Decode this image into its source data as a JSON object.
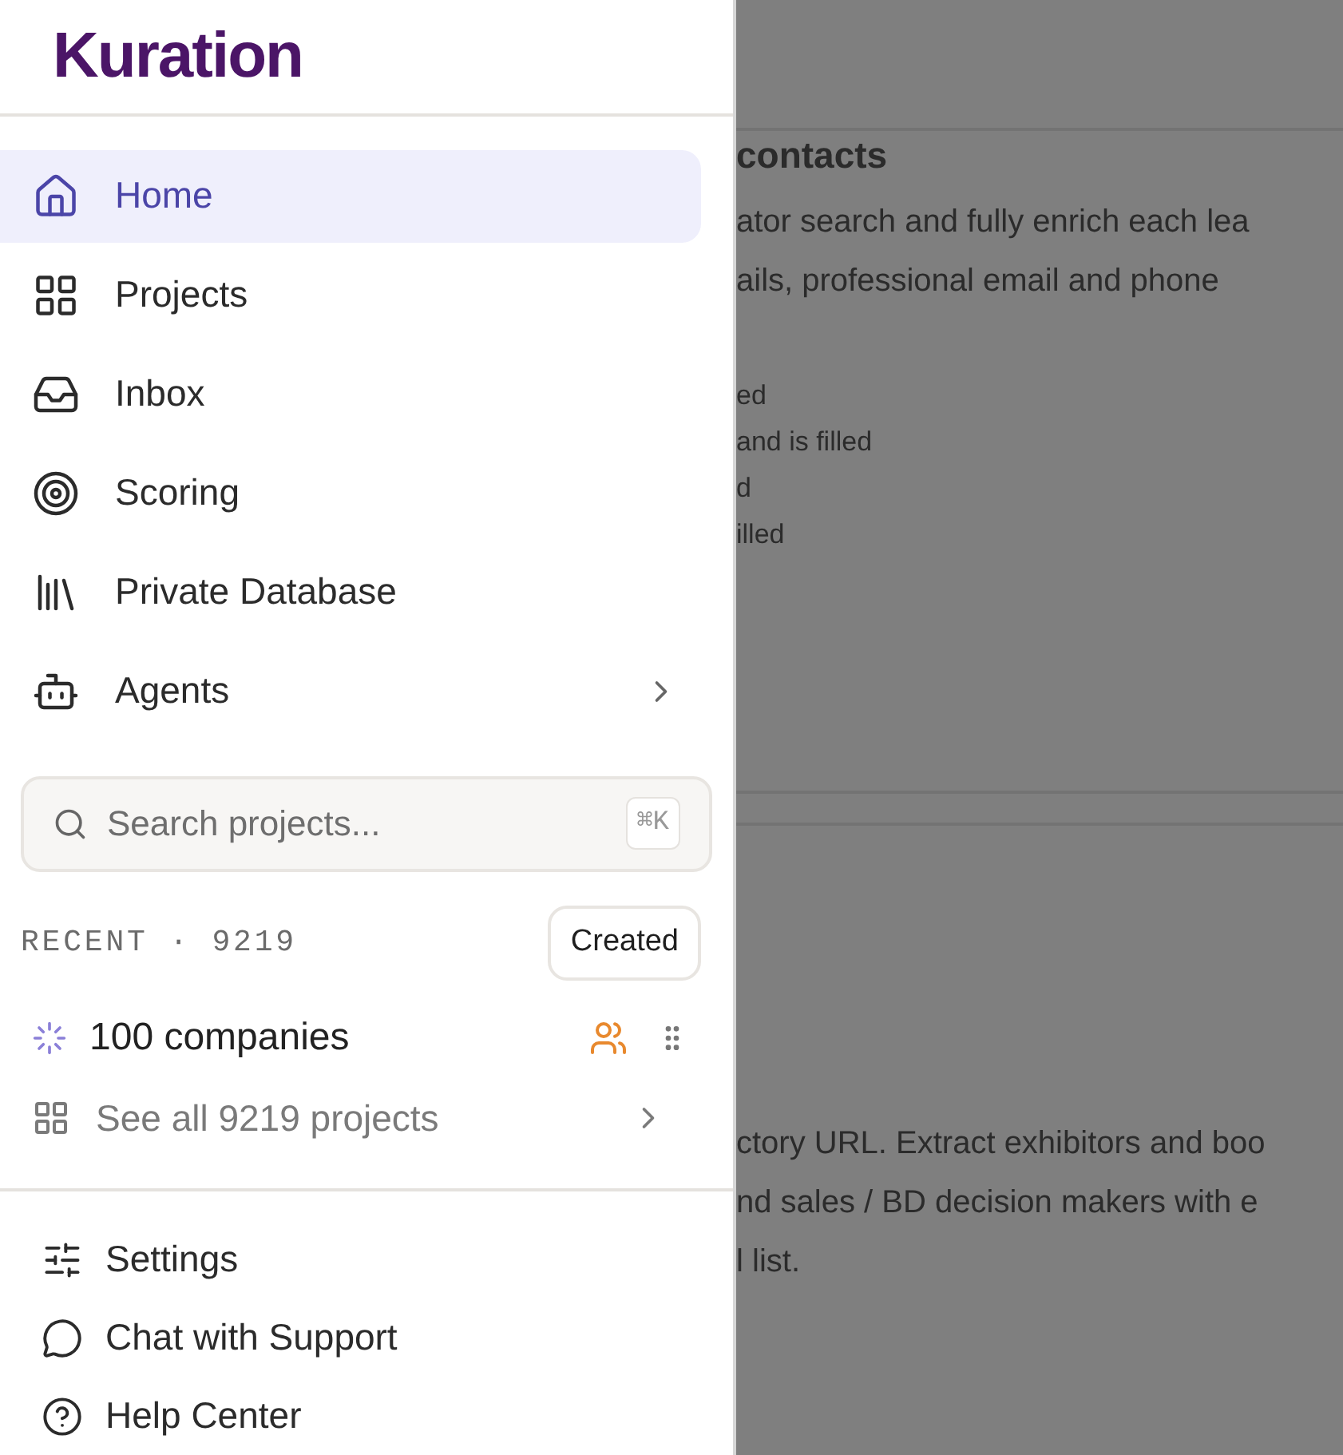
{
  "logo": "Kuration",
  "nav": [
    {
      "label": "Home",
      "selected": true,
      "has_submenu": false
    },
    {
      "label": "Projects",
      "selected": false,
      "has_submenu": false
    },
    {
      "label": "Inbox",
      "selected": false,
      "has_submenu": false
    },
    {
      "label": "Scoring",
      "selected": false,
      "has_submenu": false
    },
    {
      "label": "Private Database",
      "selected": false,
      "has_submenu": false
    },
    {
      "label": "Agents",
      "selected": false,
      "has_submenu": true
    }
  ],
  "search": {
    "placeholder": "Search projects...",
    "shortcut": "⌘K"
  },
  "recent": {
    "label": "RECENT · 9219",
    "sort": "Created",
    "projects": [
      {
        "name": "100 companies",
        "loading": true,
        "shared": true
      }
    ],
    "see_all": "See all 9219 projects"
  },
  "footer": [
    "Settings",
    "Chat with Support",
    "Help Center"
  ],
  "background": {
    "heading": "contacts",
    "paragraph_1": [
      "ator search and fully enrich each lea",
      "ails, professional email and phone"
    ],
    "list": [
      "ed",
      "and is filled",
      "d",
      "illed"
    ],
    "paragraph_2": [
      "ctory URL. Extract exhibitors and boo",
      "nd sales / BD decision makers with e",
      "l list."
    ]
  }
}
